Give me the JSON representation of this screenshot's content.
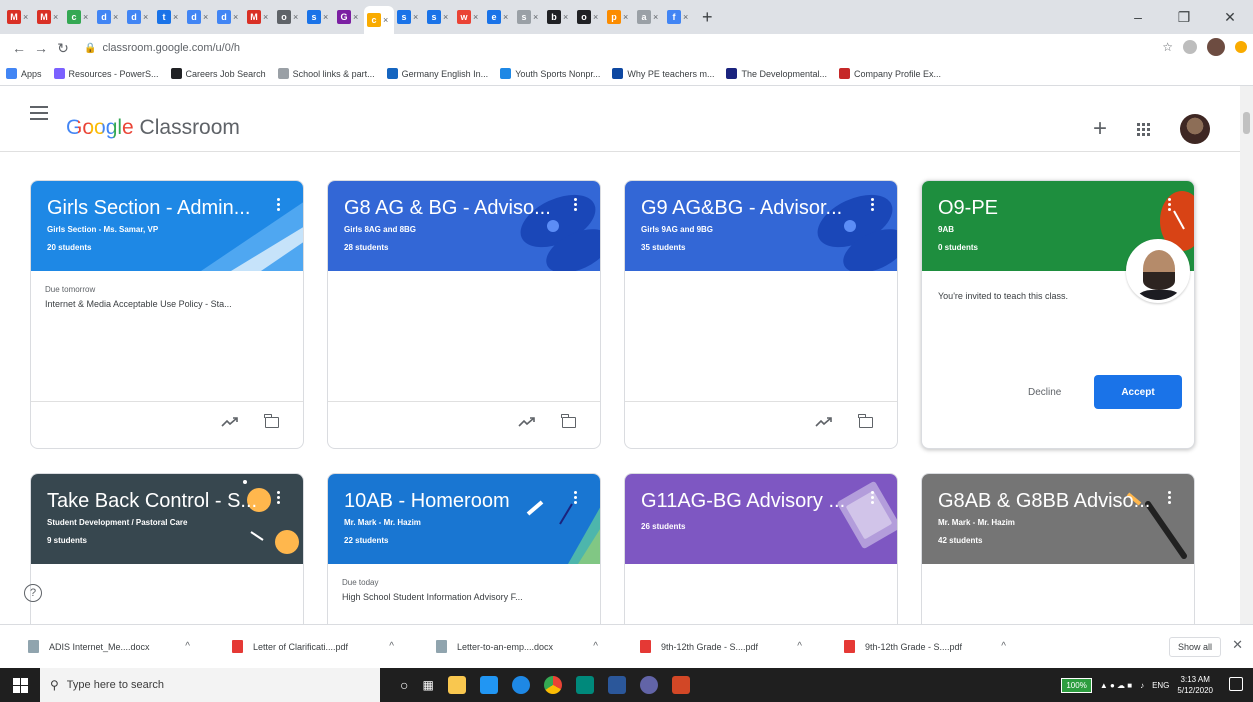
{
  "browser": {
    "tabs": [
      {
        "icon": "M",
        "color": "#d93025"
      },
      {
        "icon": "M",
        "color": "#d93025"
      },
      {
        "icon": "c",
        "color": "#34a853"
      },
      {
        "icon": "d",
        "color": "#4285f4"
      },
      {
        "icon": "d",
        "color": "#4285f4"
      },
      {
        "icon": "t",
        "color": "#1a73e8"
      },
      {
        "icon": "d",
        "color": "#4285f4"
      },
      {
        "icon": "d",
        "color": "#4285f4"
      },
      {
        "icon": "M",
        "color": "#d93025"
      },
      {
        "icon": "o",
        "color": "#5f6368"
      },
      {
        "icon": "s",
        "color": "#1a73e8"
      },
      {
        "icon": "G",
        "color": "#7b1fa2"
      },
      {
        "icon": "c",
        "color": "#f9ab00",
        "active": true
      },
      {
        "icon": "s",
        "color": "#1a73e8"
      },
      {
        "icon": "s",
        "color": "#1a73e8"
      },
      {
        "icon": "w",
        "color": "#ea4335"
      },
      {
        "icon": "e",
        "color": "#1a73e8"
      },
      {
        "icon": "s",
        "color": "#9aa0a6"
      },
      {
        "icon": "b",
        "color": "#202124"
      },
      {
        "icon": "o",
        "color": "#202124"
      },
      {
        "icon": "p",
        "color": "#fb8c00"
      },
      {
        "icon": "a",
        "color": "#9aa0a6"
      },
      {
        "icon": "f",
        "color": "#4285f4"
      }
    ],
    "url": "classroom.google.com/u/0/h",
    "bookmarks": [
      {
        "label": "Apps",
        "color": "#4285f4"
      },
      {
        "label": "Resources - PowerS...",
        "color": "#7b61ff"
      },
      {
        "label": "Careers Job Search",
        "color": "#202124"
      },
      {
        "label": "School links & part...",
        "color": "#9aa0a6"
      },
      {
        "label": "Germany English In...",
        "color": "#1565c0"
      },
      {
        "label": "Youth Sports Nonpr...",
        "color": "#1e88e5"
      },
      {
        "label": "Why PE teachers m...",
        "color": "#0d47a1"
      },
      {
        "label": "The Developmental...",
        "color": "#1a237e"
      },
      {
        "label": "Company Profile Ex...",
        "color": "#c62828"
      }
    ]
  },
  "header": {
    "brand_google": "Google",
    "brand_classroom": " Classroom"
  },
  "courses": [
    {
      "title": "Girls Section - Admin...",
      "section": "Girls Section - Ms. Samar, VP",
      "count": "20 students",
      "color": "#1e88e5",
      "due_label": "Due tomorrow",
      "assignment": "Internet & Media Acceptable Use Policy - Sta..."
    },
    {
      "title": "G8 AG & BG - Adviso...",
      "section": "Girls 8AG and 8BG",
      "count": "28 students",
      "color": "#3367d6",
      "due_label": "",
      "assignment": ""
    },
    {
      "title": "G9 AG&BG - Advisor...",
      "section": "Girls 9AG and 9BG",
      "count": "35 students",
      "color": "#3367d6",
      "due_label": "",
      "assignment": ""
    },
    {
      "title": "O9-PE",
      "section": "9AB",
      "count": "0 students",
      "color": "#1e8e3e",
      "invite": "You're invited to teach this class.",
      "decline": "Decline",
      "accept": "Accept"
    },
    {
      "title": "Take Back Control - S...",
      "section": "Student Development / Pastoral Care",
      "count": "9 students",
      "color": "#37474f",
      "due_label": "",
      "assignment": ""
    },
    {
      "title": "10AB - Homeroom",
      "section": "Mr. Mark - Mr. Hazim",
      "count": "22 students",
      "color": "#1976d2",
      "due_label": "Due today",
      "assignment": "High School Student Information Advisory F..."
    },
    {
      "title": "G11AG-BG Advisory ...",
      "section": "",
      "count": "26 students",
      "color": "#7e57c2",
      "due_label": "",
      "assignment": ""
    },
    {
      "title": "G8AB & G8BB Adviso...",
      "section": "Mr. Mark - Mr. Hazim",
      "count": "42 students",
      "color": "#757575",
      "due_label": "",
      "assignment": ""
    }
  ],
  "downloads": {
    "items": [
      {
        "name": "ADIS Internet_Me....docx",
        "type": "docx"
      },
      {
        "name": "Letter of Clarificati....pdf",
        "type": "pdf"
      },
      {
        "name": "Letter-to-an-emp....docx",
        "type": "docx"
      },
      {
        "name": "9th-12th Grade - S....pdf",
        "type": "pdf"
      },
      {
        "name": "9th-12th Grade - S....pdf",
        "type": "pdf"
      }
    ],
    "show_all": "Show all"
  },
  "taskbar": {
    "search_placeholder": "Type here to search",
    "battery": "100%",
    "language": "ENG",
    "time": "3:13 AM",
    "date": "5/12/2020"
  }
}
